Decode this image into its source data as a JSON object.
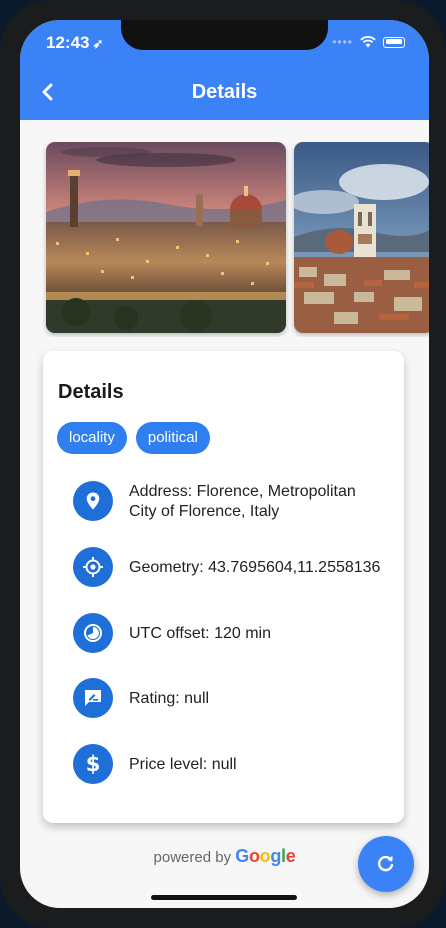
{
  "status_bar": {
    "time": "12:43",
    "location_glyph": "➶"
  },
  "app_bar": {
    "title": "Details",
    "back_icon": "chevron-left-icon"
  },
  "photos": [
    {
      "subject": "florence-cityscape-dusk"
    },
    {
      "subject": "florence-bell-tower-day"
    }
  ],
  "card": {
    "title": "Details",
    "chips": [
      "locality",
      "political"
    ],
    "rows": [
      {
        "icon": "location-pin-icon",
        "text": "Address: Florence, Metropolitan City of Florence, Italy"
      },
      {
        "icon": "gps-target-icon",
        "text": "Geometry: 43.7695604,11.2558136"
      },
      {
        "icon": "time-zone-icon",
        "text": "UTC offset: 120 min"
      },
      {
        "icon": "rate-review-icon",
        "text": "Rating: null"
      },
      {
        "icon": "dollar-icon",
        "text": "Price level: null"
      }
    ]
  },
  "attribution": {
    "prefix": "powered by ",
    "brand": "Google"
  },
  "fab": {
    "icon": "refresh-icon"
  },
  "colors": {
    "primary": "#3a82f6",
    "chip": "#2f7ff0",
    "icon_circle": "#1f6fd8",
    "google_blue": "#4285F4",
    "google_red": "#EA4335",
    "google_yellow": "#FBBC05",
    "google_green": "#34A853"
  }
}
